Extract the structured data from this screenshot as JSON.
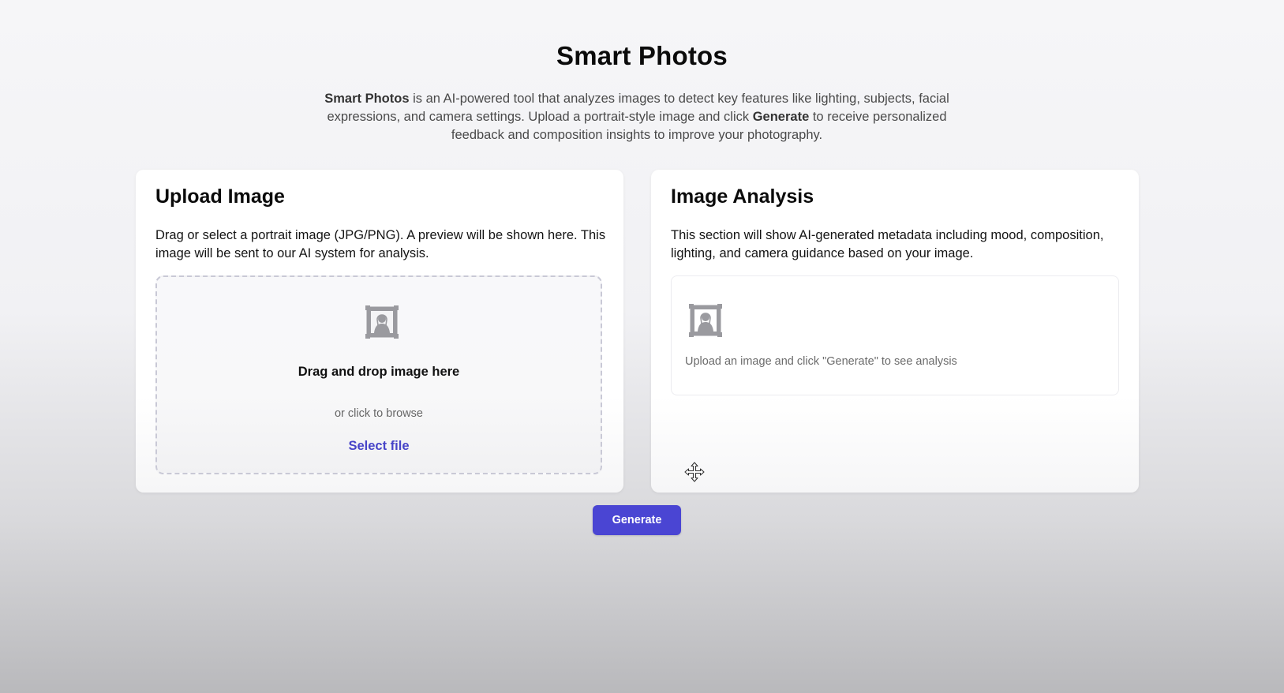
{
  "app": {
    "title": "Smart Photos",
    "intro": {
      "brand": "Smart Photos",
      "part1": " is an AI-powered tool that analyzes images to detect key features like lighting, subjects, facial expressions, and camera settings. Upload a portrait-style image and click ",
      "action": "Generate",
      "part2": " to receive personalized feedback and composition insights to improve your photography."
    }
  },
  "upload": {
    "title": "Upload Image",
    "description": "Drag or select a portrait image (JPG/PNG). A preview will be shown here. This image will be sent to our AI system for analysis.",
    "dropzone": {
      "icon": "framed-picture-icon",
      "title": "Drag and drop image here",
      "subtitle": "or click to browse",
      "select_label": "Select file"
    }
  },
  "analysis": {
    "title": "Image Analysis",
    "description": "This section will show AI-generated metadata including mood, composition, lighting, and camera guidance based on your image.",
    "icon": "framed-picture-icon",
    "placeholder": "Upload an image and click \"Generate\" to see analysis"
  },
  "actions": {
    "generate_label": "Generate"
  },
  "colors": {
    "accent": "#4a45d3",
    "link": "#4744c8",
    "icon": "#9a9a9f"
  }
}
